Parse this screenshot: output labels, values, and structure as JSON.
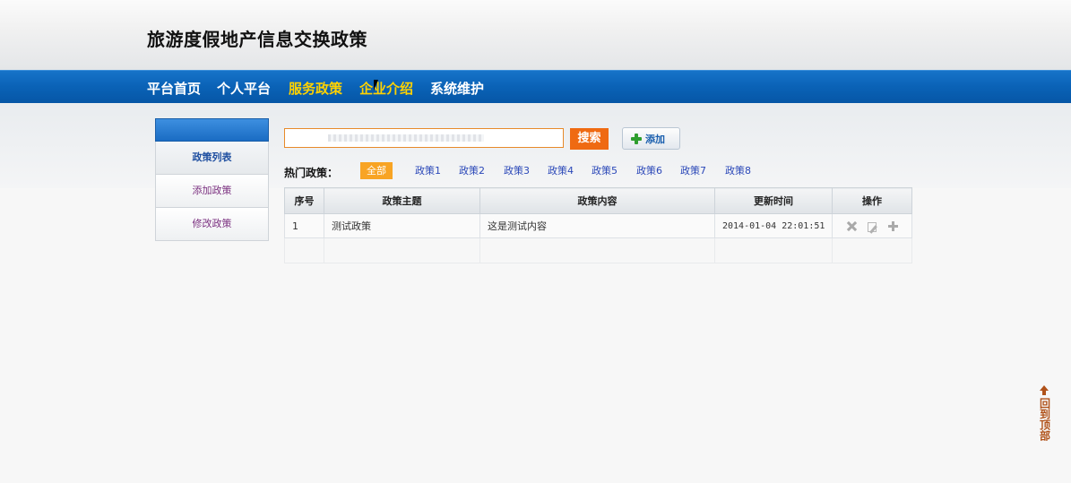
{
  "site": {
    "title": "旅游度假地产信息交换政策"
  },
  "nav": {
    "items": [
      {
        "label": "平台首页",
        "active": false
      },
      {
        "label": "个人平台",
        "active": false
      },
      {
        "label": "服务政策",
        "active": true
      },
      {
        "label": "企业介绍",
        "active": true
      },
      {
        "label": "系统维护",
        "active": false
      }
    ]
  },
  "sidebar": {
    "items": [
      {
        "label": "政策列表",
        "current": true
      },
      {
        "label": "添加政策",
        "current": false
      },
      {
        "label": "修改政策",
        "current": false
      }
    ]
  },
  "search": {
    "value": "",
    "button_label": "搜索"
  },
  "toolbar": {
    "add_label": "添加"
  },
  "hot": {
    "label": "热门政策：",
    "tags": [
      "全部",
      "政策1",
      "政策2",
      "政策3",
      "政策4",
      "政策5",
      "政策6",
      "政策7",
      "政策8"
    ],
    "active_index": 0
  },
  "table": {
    "headers": [
      "序号",
      "政策主题",
      "政策内容",
      "更新时间",
      "操作"
    ],
    "rows": [
      {
        "no": "1",
        "topic": "测试政策",
        "content": "这是测试内容",
        "time": "2014-01-04 22:01:51"
      }
    ]
  },
  "back_to_top": {
    "label": "回到顶部"
  },
  "colors": {
    "nav_bg": "#0a62b6",
    "nav_active": "#ffd200",
    "search_btn": "#ef6a12",
    "hot_active": "#f8a424",
    "link": "#2b48b8",
    "back_top": "#b0521a"
  }
}
